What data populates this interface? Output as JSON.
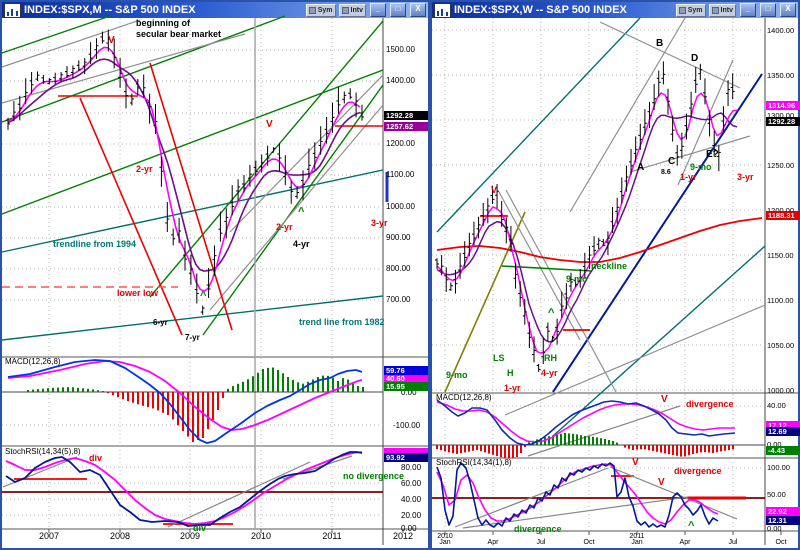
{
  "left_window": {
    "title": "INDEX:$SPX,M -- S&P 500 INDEX",
    "toolbar": {
      "sym": "Sym",
      "intv": "Intv"
    },
    "window_buttons": {
      "minimize": "_",
      "maximize": "□",
      "close": "X"
    },
    "chart": {
      "note": [
        "beginning of",
        "secular bear market"
      ],
      "trendline_1994": "trendline from 1994",
      "trendline_1982": "trend line from 1982",
      "lower_low": "lower low",
      "cycle_labels": {
        "two_yr_left": "2-yr",
        "two_yr_right": "2-yr",
        "three_yr": "3-yr",
        "four_yr": "4-yr",
        "six_yr": "6-yr",
        "seven_yr": "7-yr"
      },
      "peak_marker": "V",
      "trough_marker": "^",
      "price_ticks": [
        "1500.00",
        "1400.00",
        "1200.00",
        "1100.00",
        "1000.00",
        "900.00",
        "800.00",
        "700.00"
      ],
      "price_tags": {
        "last": "1292.28",
        "prev": "1257.62"
      }
    },
    "macd": {
      "title": "MACD(12,26,8)",
      "blue_value": "59.76",
      "magenta_value": "40.60",
      "green_value": "15.95",
      "ticks": [
        "0.00",
        "-100.00"
      ]
    },
    "stochrsi": {
      "title": "StochRSI(14,34(5),8)",
      "navy_value": "93.92",
      "ticks": [
        "80.00",
        "60.00",
        "40.00",
        "20.00",
        "0.00"
      ],
      "divergence_red": "div",
      "divergence_green": "div",
      "no_divergence": "no divergence"
    },
    "x_axis": [
      "2007",
      "2008",
      "2009",
      "2010",
      "2011",
      "2012"
    ]
  },
  "right_window": {
    "title": "INDEX:$SPX,W -- S&P 500 INDEX",
    "toolbar": {
      "sym": "Sym",
      "intv": "Intv"
    },
    "window_buttons": {
      "minimize": "_",
      "maximize": "□",
      "close": "X"
    },
    "chart": {
      "wave_labels": {
        "a": "A",
        "b": "B",
        "c": "C",
        "d": "D",
        "e": "E?",
        "c_sub": "8.6"
      },
      "neckline": "neckline",
      "head_shoulders": {
        "ls": "LS",
        "h": "H",
        "rh": "RH"
      },
      "cycle_labels": {
        "nine_mo_top": "9-mo",
        "nine_mo_mid": "9-mo",
        "nine_mo_low": "9-mo",
        "one_yr": "1-yr",
        "one_yr_low": "1-yr",
        "three_yr": "3-yr",
        "four_yr": "4-yr"
      },
      "peak_marker": "V",
      "trough_marker": "^",
      "price_ticks": [
        "1400.00",
        "1350.00",
        "1300.00",
        "1250.00",
        "1200.00",
        "1150.00",
        "1100.00",
        "1050.00",
        "1000.00"
      ],
      "price_tags": {
        "magenta": "1314.96",
        "last": "1292.28",
        "red": "1188.31"
      }
    },
    "macd": {
      "title": "MACD(12,26,8)",
      "tick_top": "40.00",
      "magenta_value": "17.12",
      "navy_value": "12.69",
      "zero": "0.00",
      "green_value": "-4.43",
      "divergence": "divergence",
      "peak_marker": "V"
    },
    "stochrsi": {
      "title": "StochRSI(14,34(1),8)",
      "tick_top": "100.00",
      "tick_mid": "50.00",
      "magenta_value": "22.92",
      "navy_value": "12.31",
      "tick_zero": "0.00",
      "divergence_red": "divergence",
      "divergence_green": "divergence",
      "peak_marker": "V",
      "trough_marker": "^"
    },
    "x_axis": [
      {
        "year": "2010",
        "month": "Jan"
      },
      {
        "month": "Apr"
      },
      {
        "month": "Jul"
      },
      {
        "month": "Oct"
      },
      {
        "year": "2011",
        "month": "Jan"
      },
      {
        "month": "Apr"
      },
      {
        "month": "Jul"
      },
      {
        "month": "Oct"
      }
    ]
  }
}
